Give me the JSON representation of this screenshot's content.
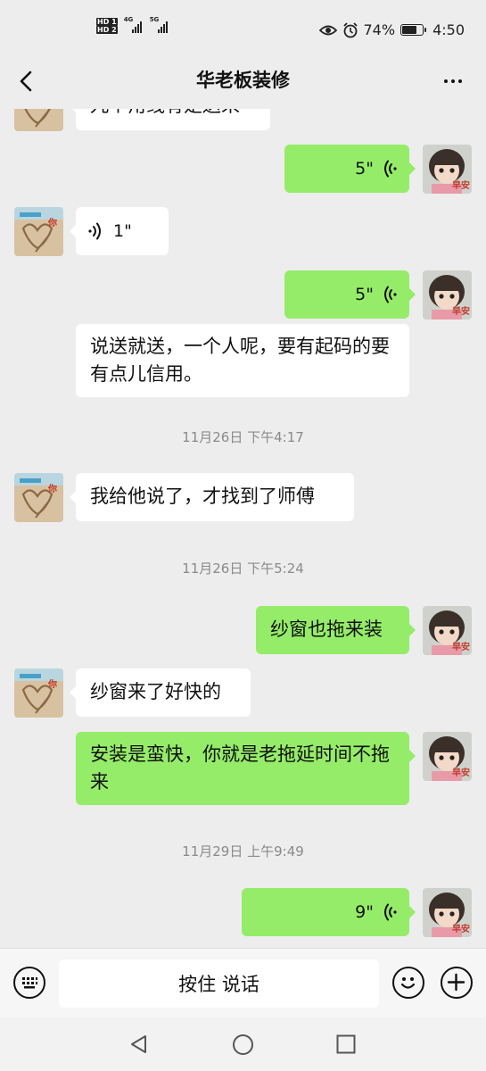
{
  "status_bar": {
    "hd1": "HD 1",
    "hd2": "HD 2",
    "net1": "4G",
    "net2": "5G",
    "battery_text": "74%",
    "battery_level": 0.74,
    "time": "4:50"
  },
  "header": {
    "title": "华老板装修"
  },
  "messages": [
    {
      "side": "in",
      "kind": "text",
      "text": "九个角线有是送来"
    },
    {
      "side": "out",
      "kind": "voice",
      "duration": "5\""
    },
    {
      "side": "in",
      "kind": "voice",
      "duration": "1\""
    },
    {
      "side": "out",
      "kind": "voice",
      "duration": "5\""
    },
    {
      "side": "in",
      "kind": "text",
      "text": "说送就送，一个人呢，要有起码的要有点儿信用。"
    },
    {
      "kind": "time",
      "text": "11月26日 下午4:17"
    },
    {
      "side": "in",
      "kind": "text",
      "text": "我给他说了，才找到了师傅"
    },
    {
      "kind": "time",
      "text": "11月26日 下午5:24"
    },
    {
      "side": "out",
      "kind": "text",
      "text": "纱窗也拖来装"
    },
    {
      "side": "in",
      "kind": "text",
      "text": "纱窗来了好快的"
    },
    {
      "side": "out",
      "kind": "text",
      "text": "安装是蛮快，你就是老拖延时间不拖来"
    },
    {
      "kind": "time",
      "text": "11月29日 上午9:49"
    },
    {
      "side": "out",
      "kind": "voice",
      "duration": "9\""
    }
  ],
  "avatars": {
    "contact_text": "你",
    "self_text": "早安"
  },
  "input_bar": {
    "hold_to_talk": "按住 说话"
  },
  "icons": {
    "back": "back-arrow-icon",
    "more": "more-dots-icon",
    "keyboard": "keyboard-icon",
    "emoji": "emoji-icon",
    "plus": "plus-icon",
    "voice_in": "voice-wave-icon",
    "voice_out": "voice-wave-icon",
    "nav_back": "nav-back-icon",
    "nav_home": "nav-home-icon",
    "nav_recent": "nav-recent-icon"
  },
  "colors": {
    "background": "#ededed",
    "out_bubble": "#95ec69",
    "in_bubble": "#ffffff",
    "timestamp": "#8a8a8a"
  }
}
